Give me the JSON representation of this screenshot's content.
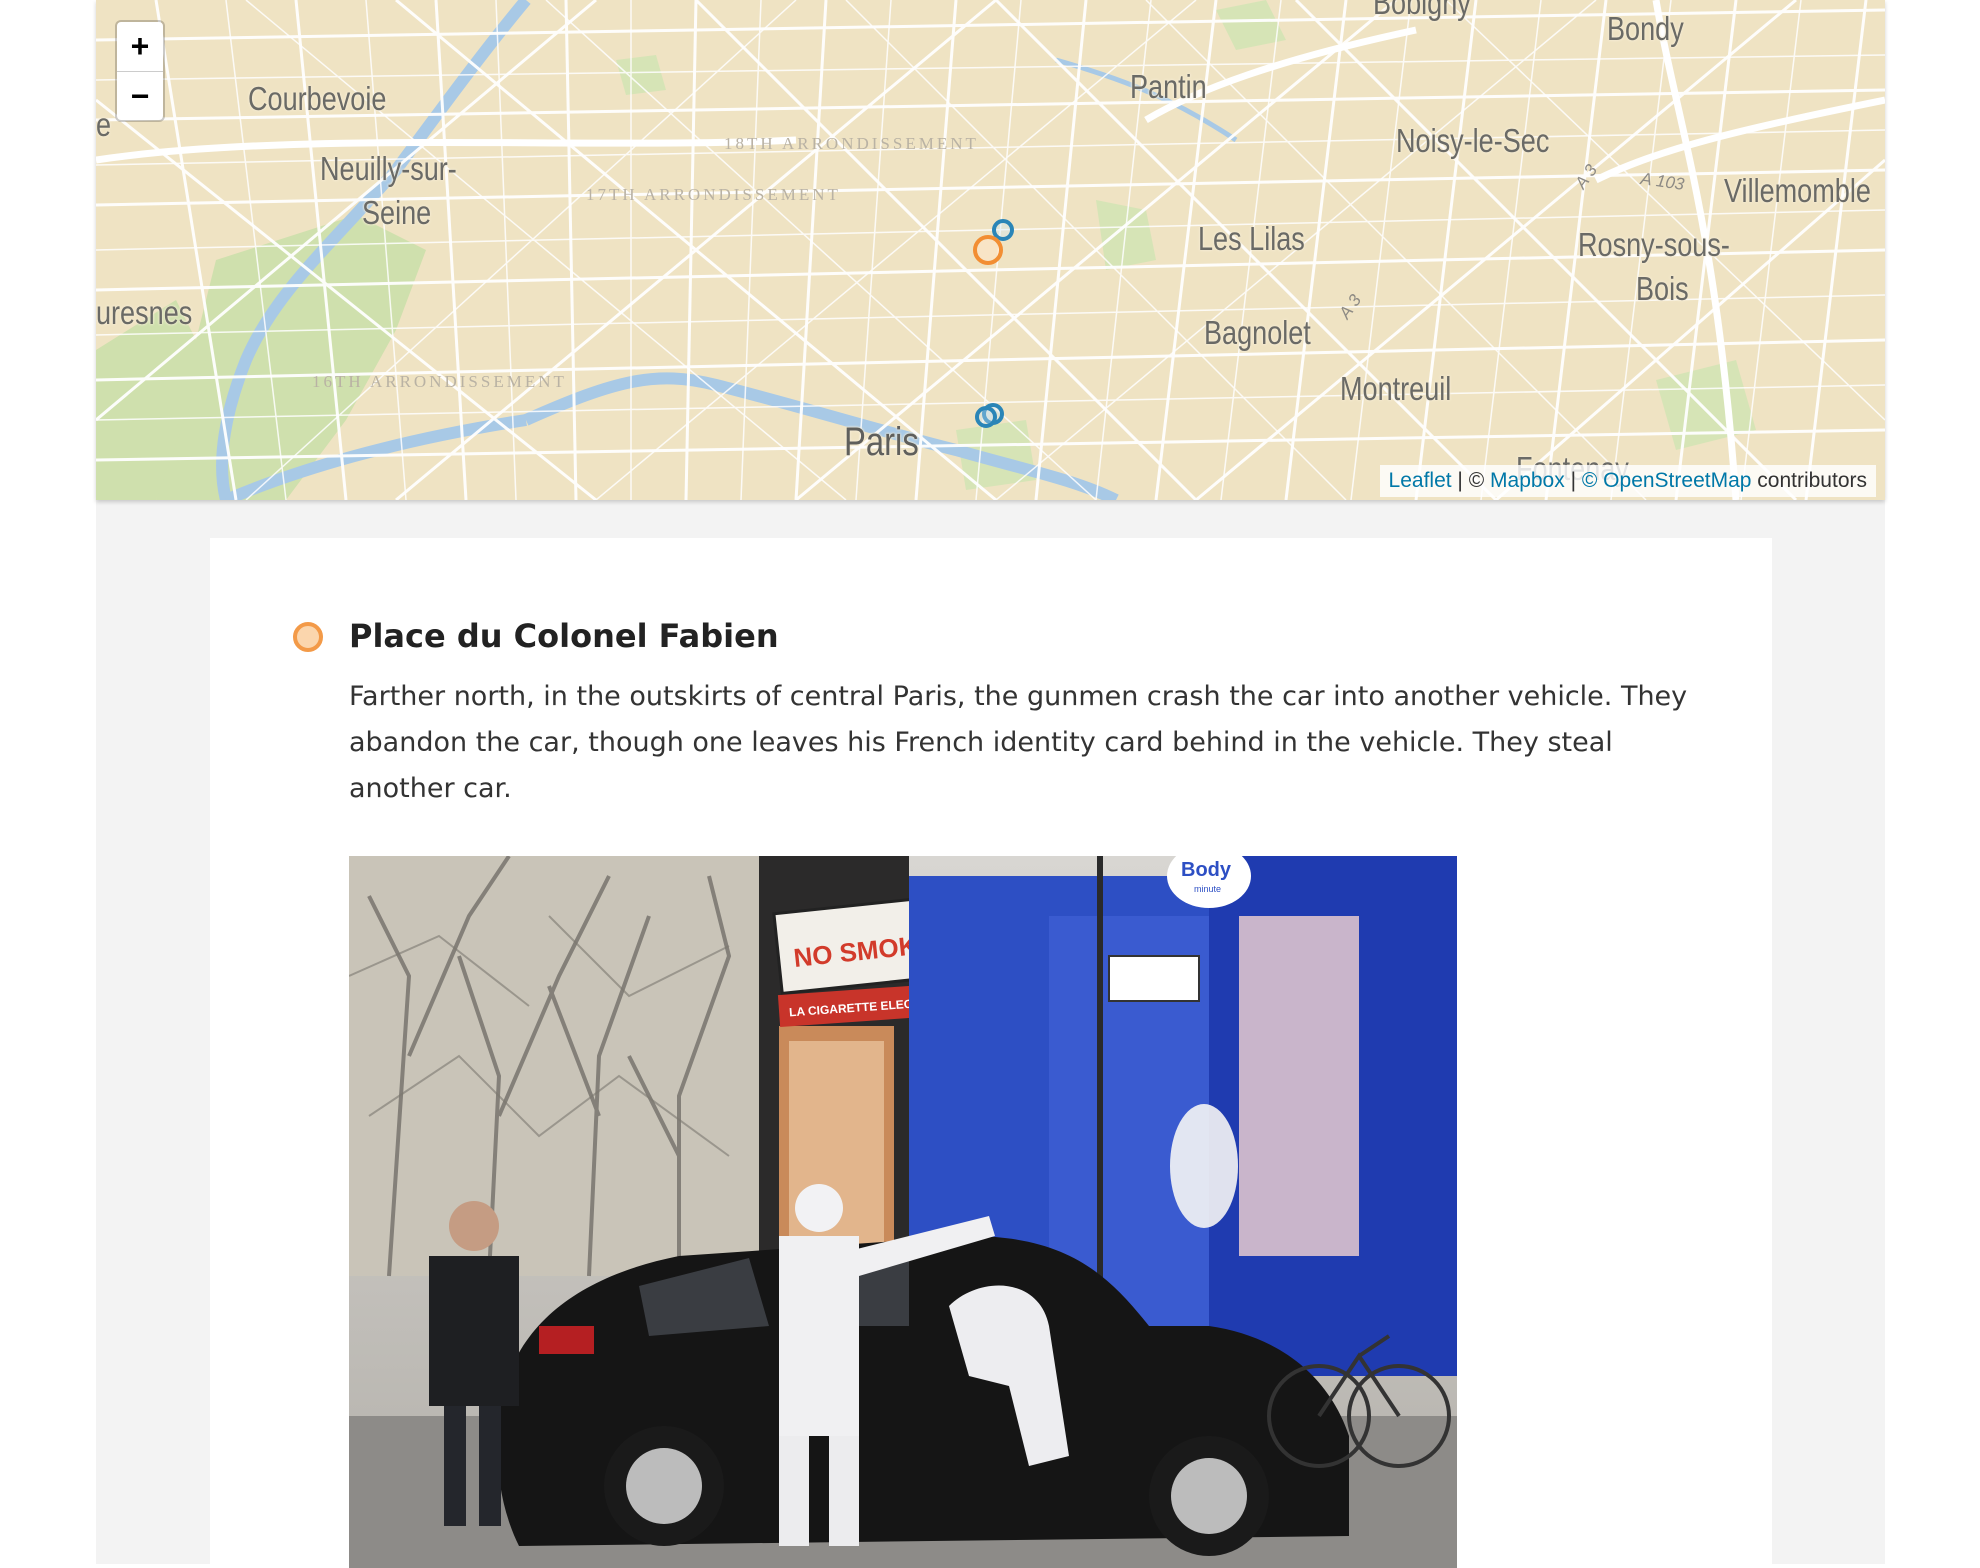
{
  "map": {
    "zoom_in_label": "+",
    "zoom_out_label": "−",
    "labels": {
      "courbevoie": "Courbevoie",
      "neuilly_1": "Neuilly-sur-",
      "neuilly_2": "Seine",
      "suresnes": "uresnes",
      "edge_left": "e",
      "arr18": "18TH ARRONDISSEMENT",
      "arr17": "17TH ARRONDISSEMENT",
      "arr16": "16TH ARRONDISSEMENT",
      "pantin": "Pantin",
      "bobigny": "Bobigny",
      "bondy": "Bondy",
      "noisy": "Noisy-le-Sec",
      "a103": "A 103",
      "a3_top": "A 3",
      "a3_mid": "A 3",
      "villemomble": "Villemomble",
      "les_lilas": "Les Lilas",
      "rosny_1": "Rosny-sous-",
      "rosny_2": "Bois",
      "bagnolet": "Bagnolet",
      "montreuil": "Montreuil",
      "paris": "Paris",
      "fontenay": "Fontenay"
    },
    "attribution": {
      "leaflet": "Leaflet",
      "sep1": " | © ",
      "mapbox": "Mapbox",
      "sep2": " | ",
      "osm": "© OpenStreetMap",
      "suffix": " contributors"
    },
    "colors": {
      "land": "#efe3c3",
      "park": "#cfe0ad",
      "water": "#a8c9e6",
      "roads": "#ffffff",
      "marker_active": "#f28e33",
      "marker_other": "#2a85b7"
    }
  },
  "entry": {
    "title": "Place du Colonel Fabien",
    "text": "Farther north, in the outskirts of central Paris, the gunmen crash the car into another vehicle. They abandon the car, though one leaves his French identity card behind in the vehicle. They steal another car.",
    "marker_color": "#f39a48"
  },
  "photo": {
    "shop_sign_1": "NO SMOKING!",
    "shop_sign_2": "LA CIGARETTE ELECTRONIQUE",
    "store_sign": "Body",
    "store_sign_sub": "minute"
  }
}
